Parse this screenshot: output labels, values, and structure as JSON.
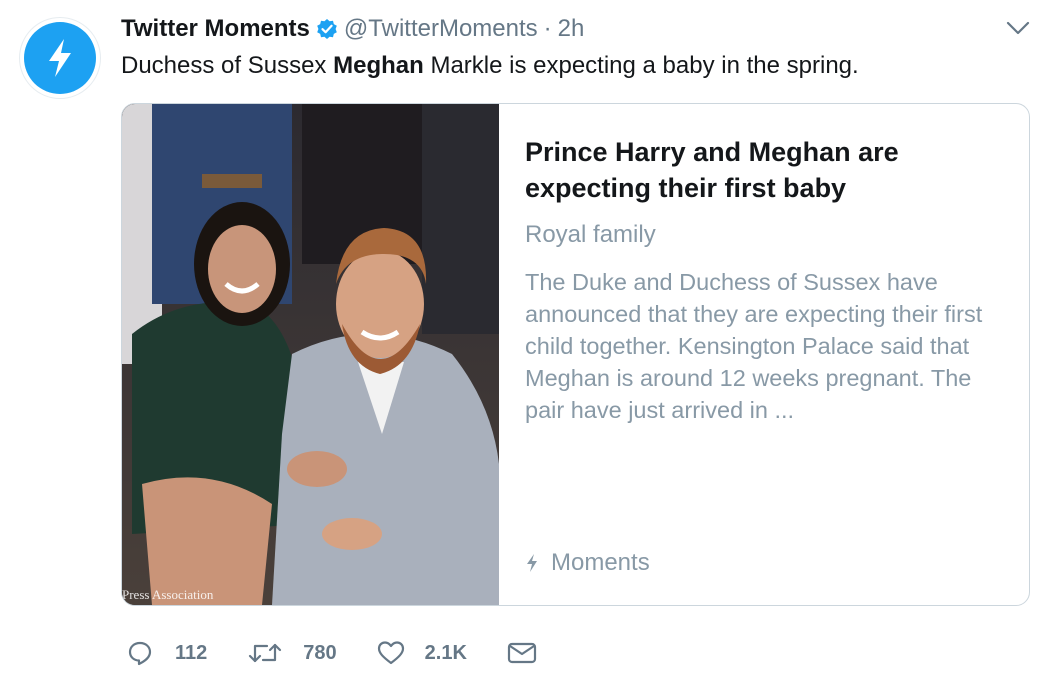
{
  "tweet": {
    "author_name": "Twitter Moments",
    "handle": "@TwitterMoments",
    "separator": "·",
    "time": "2h",
    "text_before": "Duchess of Sussex ",
    "text_bold": "Meghan",
    "text_after": " Markle is expecting a baby in the spring."
  },
  "card": {
    "title": "Prince Harry and Meghan are expecting their first baby",
    "category": "Royal family",
    "description": "The Duke and Duchess of Sussex have announced that they are expecting their first child together. Kensington Palace said that Meghan is around 12 weeks pregnant. The pair have just arrived in ...",
    "source_label": "Moments",
    "image_credit": "Press Association"
  },
  "actions": {
    "reply_count": "112",
    "retweet_count": "780",
    "like_count": "2.1K"
  },
  "icons": {
    "avatar": "lightning-bolt-icon",
    "verified": "verified-badge-icon",
    "caret": "chevron-down-icon",
    "source": "lightning-bolt-icon",
    "reply": "speech-bubble-icon",
    "retweet": "retweet-arrows-icon",
    "like": "heart-icon",
    "message": "envelope-icon"
  },
  "colors": {
    "accent": "#1da1f2",
    "text_primary": "#14171a",
    "text_secondary": "#657786",
    "card_muted": "#8899a6",
    "border": "#ccd6dd"
  }
}
